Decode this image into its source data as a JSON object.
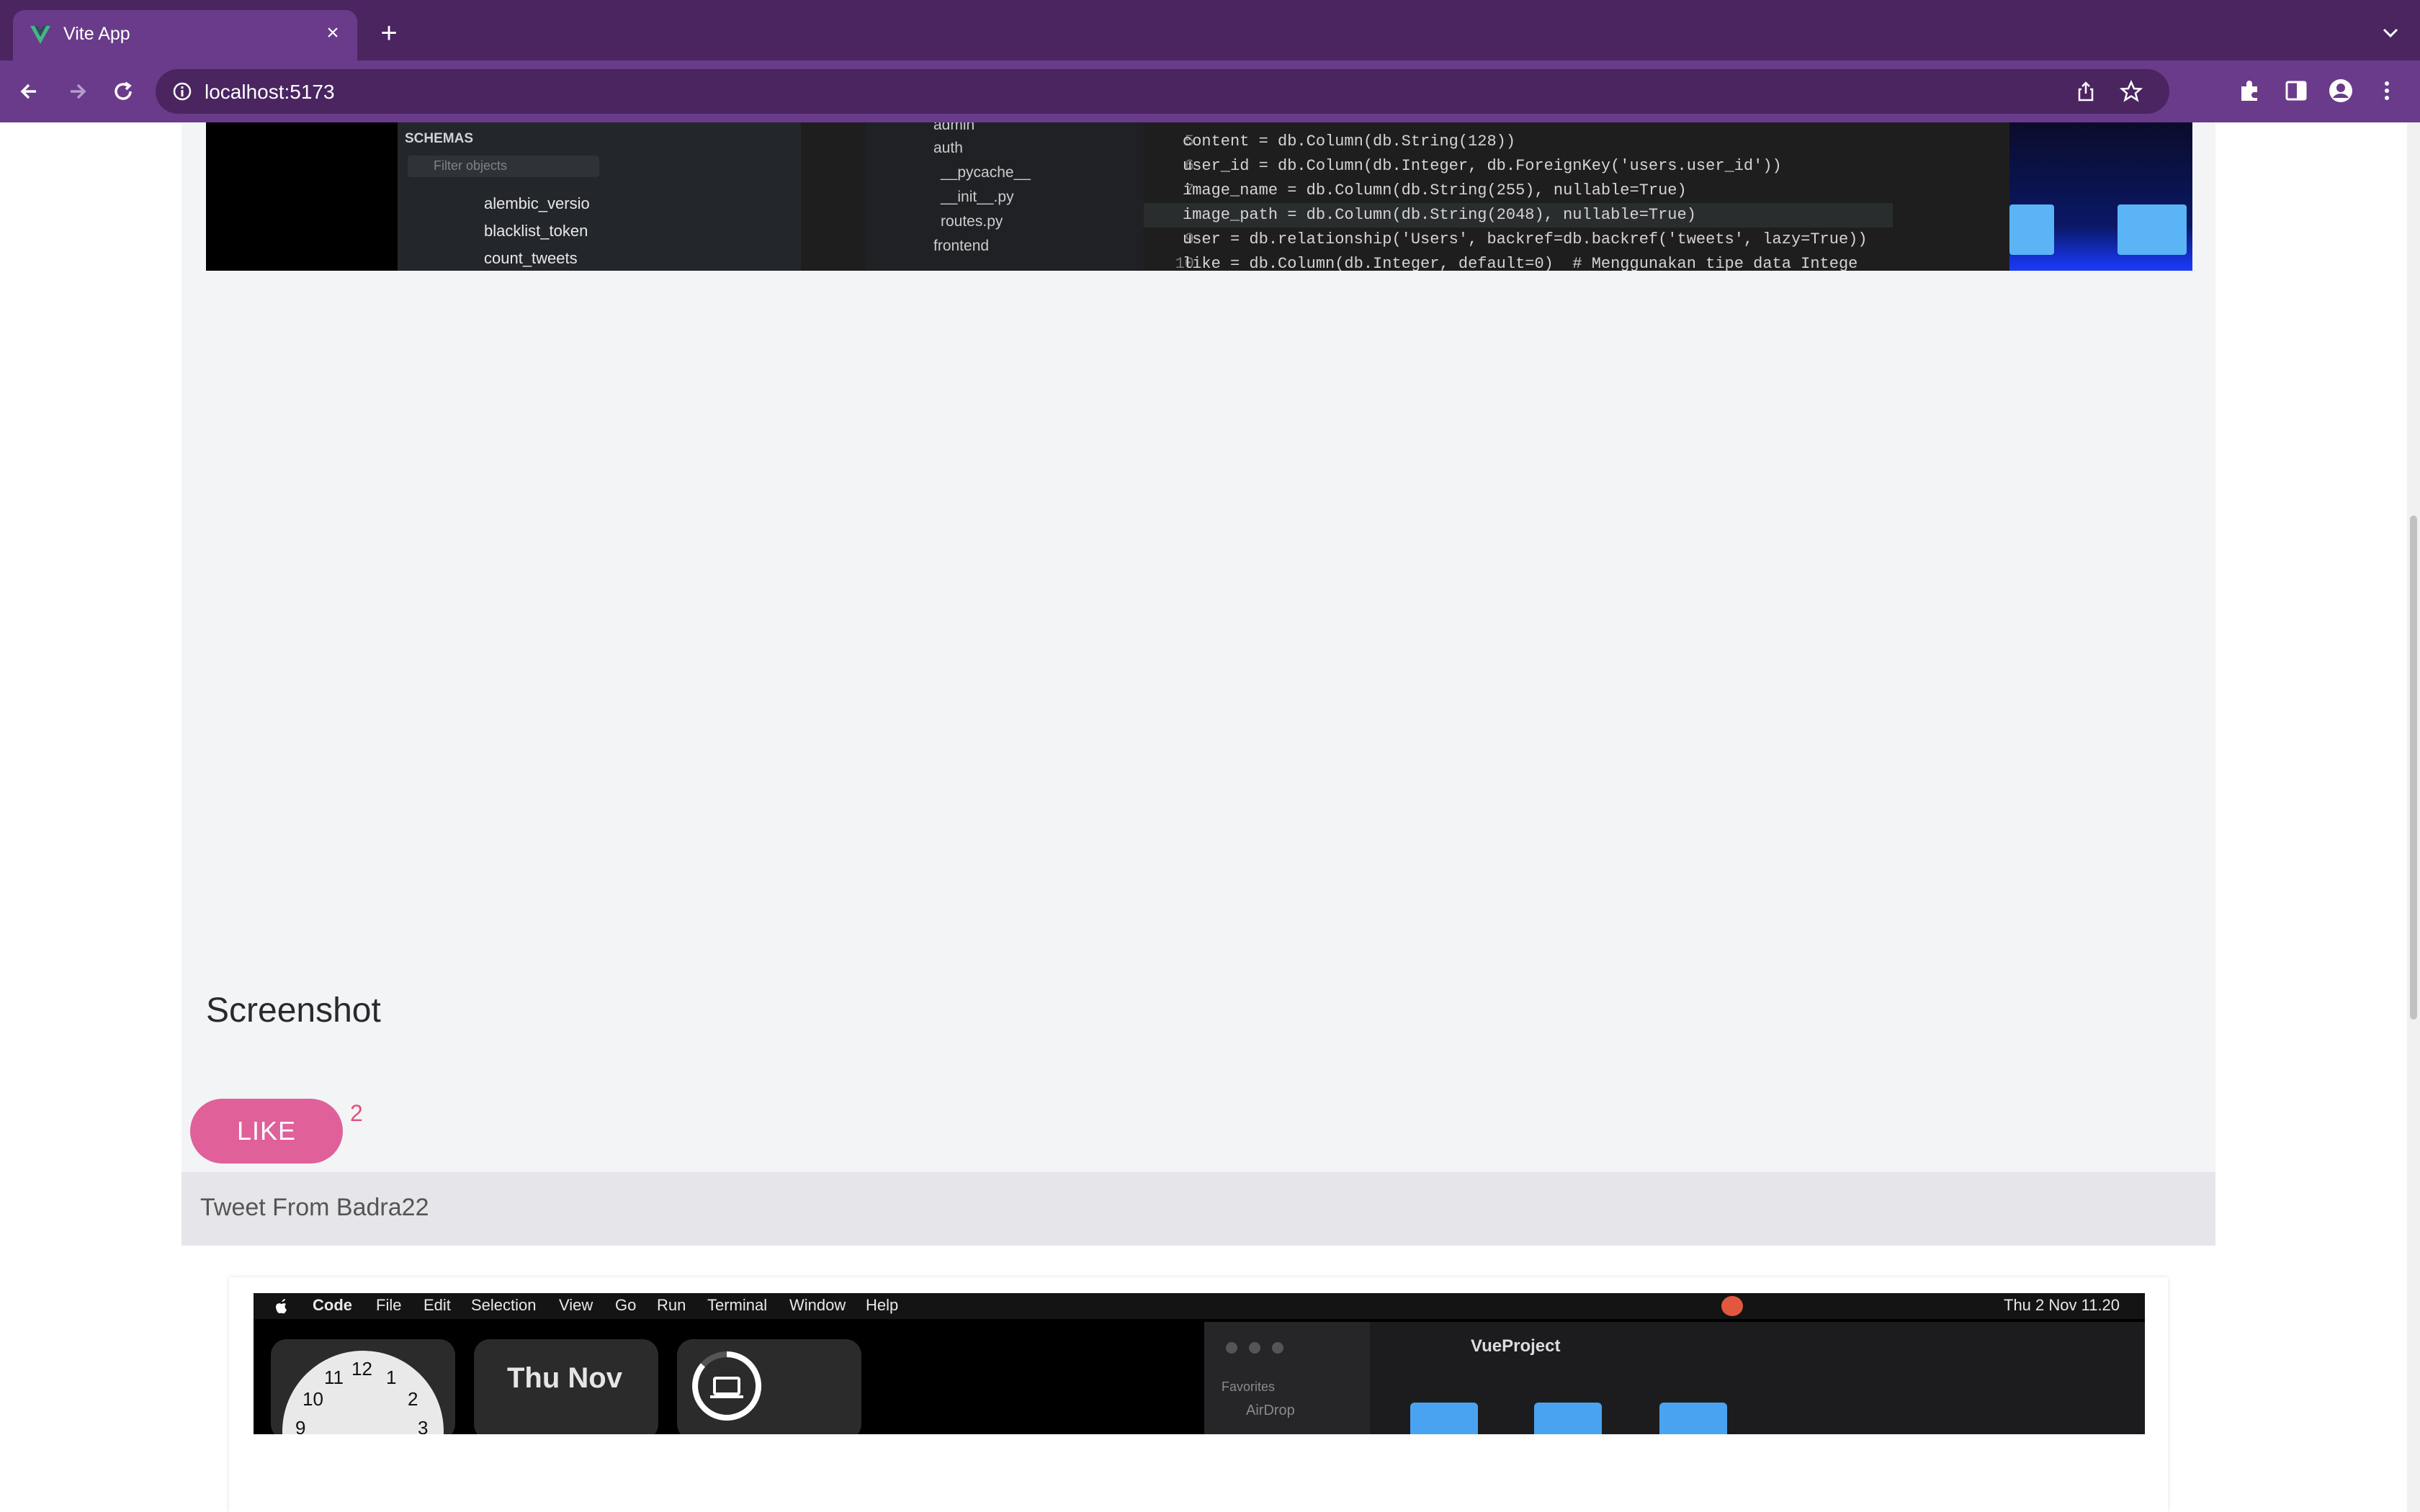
{
  "browser": {
    "tab_title": "Vite App",
    "url": "localhost:5173"
  },
  "code_shot": {
    "schemas_label": "SCHEMAS",
    "filter_placeholder": "Filter objects",
    "tables": [
      "alembic_versio",
      "blacklist_token",
      "count_tweets"
    ],
    "tree": [
      "admin",
      "auth",
      "__pycache__",
      "__init__.py",
      "routes.py",
      "frontend"
    ],
    "line_numbers": [
      "5",
      "6",
      "7",
      "8",
      "9",
      "10"
    ],
    "code_lines": [
      "content = db.Column(db.String(128))",
      "user_id = db.Column(db.Integer, db.ForeignKey('users.user_id'))",
      "image_name = db.Column(db.String(255), nullable=True)",
      "image_path = db.Column(db.String(2048), nullable=True)",
      "user = db.relationship('Users', backref=db.backref('tweets', lazy=True))",
      "like = db.Column(db.Integer, default=0)  # Menggunakan tipe data Intege"
    ]
  },
  "post": {
    "title": "Screenshot",
    "like_label": "LIKE",
    "like_count": "2",
    "author": "Tweet From Badra22"
  },
  "desktop_shot": {
    "menu": [
      "Code",
      "File",
      "Edit",
      "Selection",
      "View",
      "Go",
      "Run",
      "Terminal",
      "Window",
      "Help"
    ],
    "clock_numbers": [
      "12",
      "11",
      "1",
      "10",
      "2",
      "9",
      "3"
    ],
    "date_widget": "Thu Nov",
    "status_datetime": "Thu 2 Nov  11.20",
    "finder_title": "VueProject",
    "favorites_label": "Favorites",
    "airdrop_label": "AirDrop"
  },
  "colors": {
    "tabstrip": "#4a2560",
    "toolbar": "#6a3b8a",
    "like_button": "#e0609a",
    "like_count": "#e0507e",
    "card_bg": "#f3f4f6",
    "footer_bg": "#e5e5ea"
  }
}
